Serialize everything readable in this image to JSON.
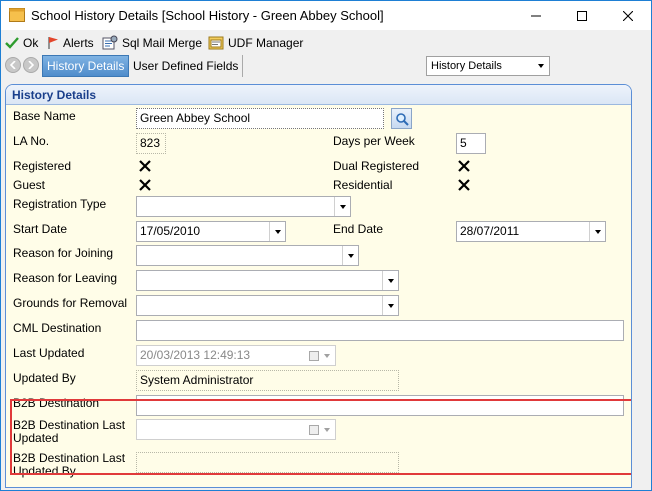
{
  "window": {
    "title": "School History Details [School History - Green Abbey School]"
  },
  "toolbar": {
    "ok": "Ok",
    "alerts": "Alerts",
    "sql_mail_merge": "Sql Mail Merge",
    "udf_manager": "UDF Manager"
  },
  "tabs": {
    "history_details": "History Details",
    "user_defined_fields": "User Defined Fields",
    "nav_select": "History Details"
  },
  "panel": {
    "title": "History Details"
  },
  "form": {
    "base_name_label": "Base Name",
    "base_name_value": "Green Abbey School",
    "la_no_label": "LA No.",
    "la_no_value": "823",
    "days_per_week_label": "Days per Week",
    "days_per_week_value": "5",
    "registered_label": "Registered",
    "dual_registered_label": "Dual Registered",
    "guest_label": "Guest",
    "residential_label": "Residential",
    "registration_type_label": "Registration Type",
    "registration_type_value": "",
    "start_date_label": "Start Date",
    "start_date_value": "17/05/2010",
    "end_date_label": "End Date",
    "end_date_value": "28/07/2011",
    "reason_joining_label": "Reason for Joining",
    "reason_joining_value": "",
    "reason_leaving_label": "Reason for Leaving",
    "reason_leaving_value": "",
    "grounds_removal_label": "Grounds for Removal",
    "grounds_removal_value": "",
    "cml_destination_label": "CML Destination",
    "cml_destination_value": "",
    "last_updated_label": "Last Updated",
    "last_updated_value": "20/03/2013 12:49:13",
    "updated_by_label": "Updated By",
    "updated_by_value": "System Administrator",
    "b2b_destination_label": "B2B Destination",
    "b2b_destination_value": "",
    "b2b_last_updated_label": "B2B Destination Last Updated",
    "b2b_last_updated_value": "",
    "b2b_last_updated_by_label": "B2B Destination Last Updated By",
    "b2b_last_updated_by_value": ""
  },
  "colors": {
    "panel_background": "#fffde8",
    "panel_border": "#5b8ed6",
    "panel_title": "#1a3f8b",
    "active_tab": "#5b9bd5",
    "highlight_border": "#e0393a"
  }
}
